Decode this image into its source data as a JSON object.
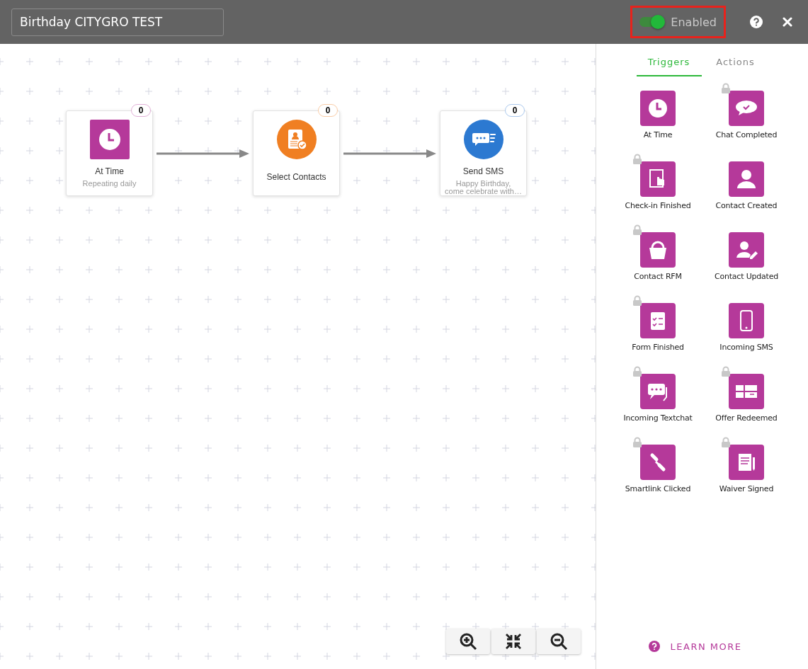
{
  "header": {
    "title_value": "Birthday CITYGRO TEST",
    "toggle": {
      "label": "Enabled",
      "on": true,
      "highlighted": true
    }
  },
  "canvas": {
    "nodes": [
      {
        "kind": "trigger",
        "title": "At Time",
        "subtitle": "Repeating daily",
        "count": "0",
        "color": "#b5399a"
      },
      {
        "kind": "action",
        "title": "Select Contacts",
        "count": "0",
        "color": "#f07f22"
      },
      {
        "kind": "action",
        "title": "Send SMS",
        "subtitle": "Happy Birthday,\ncome celebrate with…",
        "count": "0",
        "color": "#2c79d1"
      }
    ]
  },
  "sidebar": {
    "tabs": [
      {
        "label": "Triggers",
        "selected": true
      },
      {
        "label": "Actions",
        "selected": false
      }
    ],
    "items": [
      {
        "label": "At Time",
        "locked": false
      },
      {
        "label": "Chat Completed",
        "locked": true
      },
      {
        "label": "Check-in Finished",
        "locked": true
      },
      {
        "label": "Contact Created",
        "locked": false
      },
      {
        "label": "Contact RFM",
        "locked": true
      },
      {
        "label": "Contact Updated",
        "locked": false
      },
      {
        "label": "Form Finished",
        "locked": true
      },
      {
        "label": "Incoming SMS",
        "locked": false
      },
      {
        "label": "Incoming Textchat",
        "locked": true
      },
      {
        "label": "Offer Redeemed",
        "locked": true
      },
      {
        "label": "Smartlink Clicked",
        "locked": true
      },
      {
        "label": "Waiver Signed",
        "locked": true
      }
    ],
    "learn_more": "LEARN MORE"
  }
}
